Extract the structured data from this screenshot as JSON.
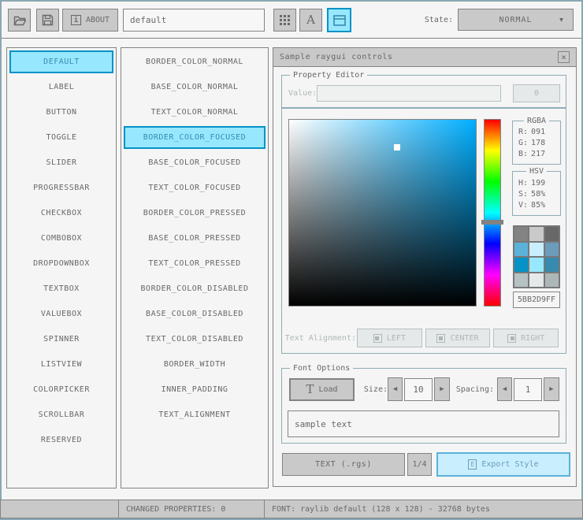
{
  "toolbar": {
    "about_label": "ABOUT",
    "style_name_value": "default",
    "state_label": "State:",
    "state_value": "NORMAL",
    "icons": [
      "open-file-icon",
      "save-file-icon",
      "about-info-icon",
      "style-grid-icon",
      "font-icon",
      "controls-window-icon",
      "dropdown-arrow-icon"
    ],
    "glyphs": {
      "info": "i",
      "font": "A",
      "dropdown_arrow": "▼"
    }
  },
  "controls_list": {
    "items": [
      "DEFAULT",
      "LABEL",
      "BUTTON",
      "TOGGLE",
      "SLIDER",
      "PROGRESSBAR",
      "CHECKBOX",
      "COMBOBOX",
      "DROPDOWNBOX",
      "TEXTBOX",
      "VALUEBOX",
      "SPINNER",
      "LISTVIEW",
      "COLORPICKER",
      "SCROLLBAR",
      "RESERVED"
    ],
    "selected": "DEFAULT"
  },
  "properties_list": {
    "items": [
      "BORDER_COLOR_NORMAL",
      "BASE_COLOR_NORMAL",
      "TEXT_COLOR_NORMAL",
      "BORDER_COLOR_FOCUSED",
      "BASE_COLOR_FOCUSED",
      "TEXT_COLOR_FOCUSED",
      "BORDER_COLOR_PRESSED",
      "BASE_COLOR_PRESSED",
      "TEXT_COLOR_PRESSED",
      "BORDER_COLOR_DISABLED",
      "BASE_COLOR_DISABLED",
      "TEXT_COLOR_DISABLED",
      "BORDER_WIDTH",
      "INNER_PADDING",
      "TEXT_ALIGNMENT"
    ],
    "selected": "BORDER_COLOR_FOCUSED"
  },
  "sample_window": {
    "title": "Sample raygui controls",
    "close_glyph": "×",
    "property_editor": {
      "label": "Property Editor",
      "value_label": "Value:",
      "value": "",
      "button_label": "0"
    },
    "color_picker": {
      "hue": 199,
      "saturation": 58,
      "value": 85,
      "rgba": {
        "label": "RGBA",
        "r_label": "R:",
        "r": "091",
        "g_label": "G:",
        "g": "178",
        "b_label": "B:",
        "b": "217"
      },
      "hsv": {
        "label": "HSV",
        "h_label": "H:",
        "h": "199",
        "s_label": "S:",
        "s": "58%",
        "v_label": "V:",
        "v": "85%"
      },
      "swatches": [
        "#838383",
        "#c9c9c9",
        "#686868",
        "#5bb2d9",
        "#c9effe",
        "#6c9bbc",
        "#0492c7",
        "#97e8ff",
        "#368baf",
        "#b5c1c2",
        "#e6e9e9",
        "#aeb7b8"
      ],
      "hex_value": "5BB2D9FF"
    },
    "text_alignment": {
      "label": "Text Alignment:",
      "buttons": [
        {
          "label": "LEFT",
          "align": "left"
        },
        {
          "label": "CENTER",
          "align": "center"
        },
        {
          "label": "RIGHT",
          "align": "right"
        }
      ]
    },
    "font_options": {
      "label": "Font Options",
      "load_label": "Load",
      "load_glyph": "T",
      "size_label": "Size:",
      "size_value": "10",
      "spacing_label": "Spacing:",
      "spacing_value": "1",
      "arrow_left": "◀",
      "arrow_right": "▶",
      "sample_text": "sample text"
    },
    "export": {
      "text_button": "TEXT (.rgs)",
      "pager": "1/4",
      "export_button": "Export Style",
      "export_glyph": "E"
    }
  },
  "status_bar": {
    "changed_properties": "CHANGED PROPERTIES: 0",
    "font_info": "FONT: raylib default (128 x 128) - 32768 bytes"
  },
  "colors": {
    "background": "#f5f5f5",
    "line": "#90abb5",
    "outer_border": "#8ba6b3",
    "border_normal": "#838383",
    "base_normal": "#c9c9c9",
    "text_normal": "#686868",
    "border_focused": "#5bb2d9",
    "base_focused": "#c9effe",
    "text_focused": "#6c9bbc",
    "border_pressed": "#0492c7",
    "base_pressed": "#97e8ff",
    "text_pressed": "#368baf",
    "border_disabled": "#b5c1c2",
    "base_disabled": "#e6e9e9",
    "text_disabled": "#aeb7b8"
  }
}
